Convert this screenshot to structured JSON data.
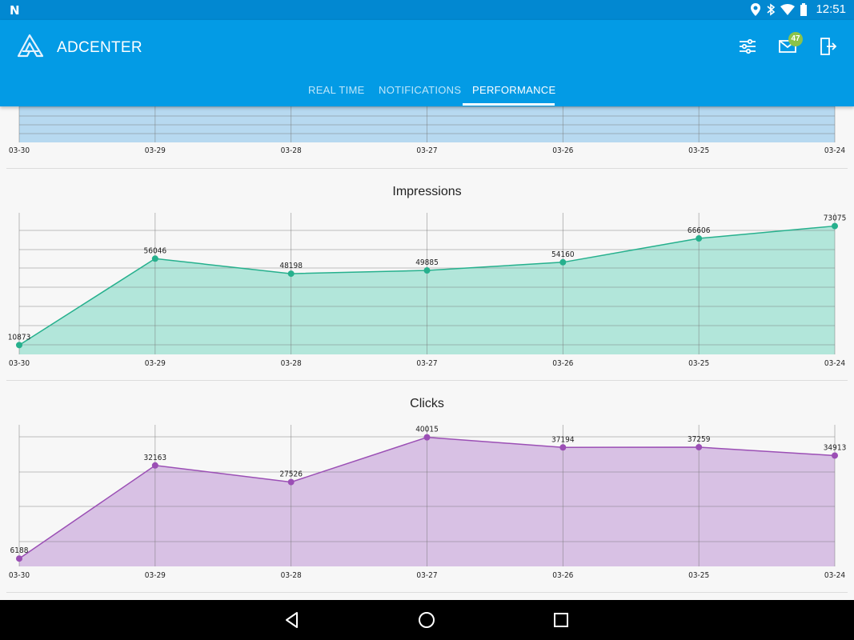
{
  "status_bar": {
    "time": "12:51"
  },
  "app": {
    "title": "ADCENTER",
    "notification_count": "47"
  },
  "tabs": [
    {
      "label": "REAL TIME"
    },
    {
      "label": "NOTIFICATIONS"
    },
    {
      "label": "PERFORMANCE"
    }
  ],
  "active_tab": "PERFORMANCE",
  "colors": {
    "app_bar": "#039be5",
    "status_bar": "#0288d1",
    "top_chart_fill": "#b7d9f0",
    "impressions_line": "#26b08d",
    "impressions_fill": "#b2e6da",
    "clicks_line": "#9b4fb5",
    "clicks_fill": "#d8c1e4",
    "badge": "#8bc34a"
  },
  "chart_data": [
    {
      "type": "area",
      "title": "",
      "categories": [
        "03-30",
        "03-29",
        "03-28",
        "03-27",
        "03-26",
        "03-25",
        "03-24"
      ],
      "series": [],
      "grid": true,
      "note_partially_scrolled": true
    },
    {
      "type": "area",
      "title": "Impressions",
      "categories": [
        "03-30",
        "03-29",
        "03-28",
        "03-27",
        "03-26",
        "03-25",
        "03-24"
      ],
      "series": [
        {
          "values": [
            10873,
            56046,
            48198,
            49885,
            54160,
            66606,
            73075
          ]
        }
      ],
      "ylim": [
        6000,
        80000
      ],
      "grid": true
    },
    {
      "type": "area",
      "title": "Clicks",
      "categories": [
        "03-30",
        "03-29",
        "03-28",
        "03-27",
        "03-26",
        "03-25",
        "03-24"
      ],
      "series": [
        {
          "values": [
            6188,
            32163,
            27526,
            40015,
            37194,
            37259,
            34913
          ]
        }
      ],
      "ylim": [
        4000,
        43500
      ],
      "grid": true
    }
  ]
}
